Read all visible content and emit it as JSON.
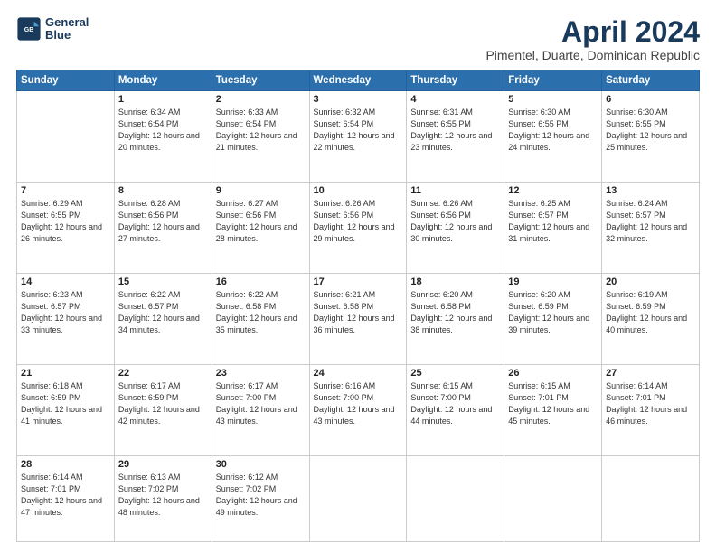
{
  "header": {
    "logo": {
      "line1": "General",
      "line2": "Blue"
    },
    "title": "April 2024",
    "subtitle": "Pimentel, Duarte, Dominican Republic"
  },
  "weekdays": [
    "Sunday",
    "Monday",
    "Tuesday",
    "Wednesday",
    "Thursday",
    "Friday",
    "Saturday"
  ],
  "weeks": [
    [
      {
        "day": "",
        "sunrise": "",
        "sunset": "",
        "daylight": ""
      },
      {
        "day": "1",
        "sunrise": "Sunrise: 6:34 AM",
        "sunset": "Sunset: 6:54 PM",
        "daylight": "Daylight: 12 hours and 20 minutes."
      },
      {
        "day": "2",
        "sunrise": "Sunrise: 6:33 AM",
        "sunset": "Sunset: 6:54 PM",
        "daylight": "Daylight: 12 hours and 21 minutes."
      },
      {
        "day": "3",
        "sunrise": "Sunrise: 6:32 AM",
        "sunset": "Sunset: 6:54 PM",
        "daylight": "Daylight: 12 hours and 22 minutes."
      },
      {
        "day": "4",
        "sunrise": "Sunrise: 6:31 AM",
        "sunset": "Sunset: 6:55 PM",
        "daylight": "Daylight: 12 hours and 23 minutes."
      },
      {
        "day": "5",
        "sunrise": "Sunrise: 6:30 AM",
        "sunset": "Sunset: 6:55 PM",
        "daylight": "Daylight: 12 hours and 24 minutes."
      },
      {
        "day": "6",
        "sunrise": "Sunrise: 6:30 AM",
        "sunset": "Sunset: 6:55 PM",
        "daylight": "Daylight: 12 hours and 25 minutes."
      }
    ],
    [
      {
        "day": "7",
        "sunrise": "Sunrise: 6:29 AM",
        "sunset": "Sunset: 6:55 PM",
        "daylight": "Daylight: 12 hours and 26 minutes."
      },
      {
        "day": "8",
        "sunrise": "Sunrise: 6:28 AM",
        "sunset": "Sunset: 6:56 PM",
        "daylight": "Daylight: 12 hours and 27 minutes."
      },
      {
        "day": "9",
        "sunrise": "Sunrise: 6:27 AM",
        "sunset": "Sunset: 6:56 PM",
        "daylight": "Daylight: 12 hours and 28 minutes."
      },
      {
        "day": "10",
        "sunrise": "Sunrise: 6:26 AM",
        "sunset": "Sunset: 6:56 PM",
        "daylight": "Daylight: 12 hours and 29 minutes."
      },
      {
        "day": "11",
        "sunrise": "Sunrise: 6:26 AM",
        "sunset": "Sunset: 6:56 PM",
        "daylight": "Daylight: 12 hours and 30 minutes."
      },
      {
        "day": "12",
        "sunrise": "Sunrise: 6:25 AM",
        "sunset": "Sunset: 6:57 PM",
        "daylight": "Daylight: 12 hours and 31 minutes."
      },
      {
        "day": "13",
        "sunrise": "Sunrise: 6:24 AM",
        "sunset": "Sunset: 6:57 PM",
        "daylight": "Daylight: 12 hours and 32 minutes."
      }
    ],
    [
      {
        "day": "14",
        "sunrise": "Sunrise: 6:23 AM",
        "sunset": "Sunset: 6:57 PM",
        "daylight": "Daylight: 12 hours and 33 minutes."
      },
      {
        "day": "15",
        "sunrise": "Sunrise: 6:22 AM",
        "sunset": "Sunset: 6:57 PM",
        "daylight": "Daylight: 12 hours and 34 minutes."
      },
      {
        "day": "16",
        "sunrise": "Sunrise: 6:22 AM",
        "sunset": "Sunset: 6:58 PM",
        "daylight": "Daylight: 12 hours and 35 minutes."
      },
      {
        "day": "17",
        "sunrise": "Sunrise: 6:21 AM",
        "sunset": "Sunset: 6:58 PM",
        "daylight": "Daylight: 12 hours and 36 minutes."
      },
      {
        "day": "18",
        "sunrise": "Sunrise: 6:20 AM",
        "sunset": "Sunset: 6:58 PM",
        "daylight": "Daylight: 12 hours and 38 minutes."
      },
      {
        "day": "19",
        "sunrise": "Sunrise: 6:20 AM",
        "sunset": "Sunset: 6:59 PM",
        "daylight": "Daylight: 12 hours and 39 minutes."
      },
      {
        "day": "20",
        "sunrise": "Sunrise: 6:19 AM",
        "sunset": "Sunset: 6:59 PM",
        "daylight": "Daylight: 12 hours and 40 minutes."
      }
    ],
    [
      {
        "day": "21",
        "sunrise": "Sunrise: 6:18 AM",
        "sunset": "Sunset: 6:59 PM",
        "daylight": "Daylight: 12 hours and 41 minutes."
      },
      {
        "day": "22",
        "sunrise": "Sunrise: 6:17 AM",
        "sunset": "Sunset: 6:59 PM",
        "daylight": "Daylight: 12 hours and 42 minutes."
      },
      {
        "day": "23",
        "sunrise": "Sunrise: 6:17 AM",
        "sunset": "Sunset: 7:00 PM",
        "daylight": "Daylight: 12 hours and 43 minutes."
      },
      {
        "day": "24",
        "sunrise": "Sunrise: 6:16 AM",
        "sunset": "Sunset: 7:00 PM",
        "daylight": "Daylight: 12 hours and 43 minutes."
      },
      {
        "day": "25",
        "sunrise": "Sunrise: 6:15 AM",
        "sunset": "Sunset: 7:00 PM",
        "daylight": "Daylight: 12 hours and 44 minutes."
      },
      {
        "day": "26",
        "sunrise": "Sunrise: 6:15 AM",
        "sunset": "Sunset: 7:01 PM",
        "daylight": "Daylight: 12 hours and 45 minutes."
      },
      {
        "day": "27",
        "sunrise": "Sunrise: 6:14 AM",
        "sunset": "Sunset: 7:01 PM",
        "daylight": "Daylight: 12 hours and 46 minutes."
      }
    ],
    [
      {
        "day": "28",
        "sunrise": "Sunrise: 6:14 AM",
        "sunset": "Sunset: 7:01 PM",
        "daylight": "Daylight: 12 hours and 47 minutes."
      },
      {
        "day": "29",
        "sunrise": "Sunrise: 6:13 AM",
        "sunset": "Sunset: 7:02 PM",
        "daylight": "Daylight: 12 hours and 48 minutes."
      },
      {
        "day": "30",
        "sunrise": "Sunrise: 6:12 AM",
        "sunset": "Sunset: 7:02 PM",
        "daylight": "Daylight: 12 hours and 49 minutes."
      },
      {
        "day": "",
        "sunrise": "",
        "sunset": "",
        "daylight": ""
      },
      {
        "day": "",
        "sunrise": "",
        "sunset": "",
        "daylight": ""
      },
      {
        "day": "",
        "sunrise": "",
        "sunset": "",
        "daylight": ""
      },
      {
        "day": "",
        "sunrise": "",
        "sunset": "",
        "daylight": ""
      }
    ]
  ]
}
